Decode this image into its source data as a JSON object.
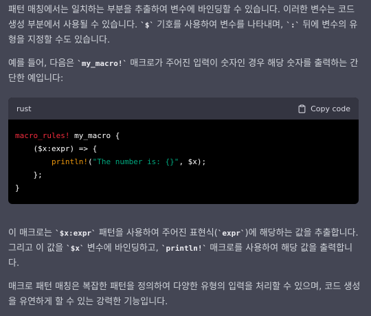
{
  "para1": {
    "t1": "패턴 매칭에서는 일치하는 부분을 추출하여 변수에 바인딩할 수 있습니다. 이러한 변수는 코드 생성 부분에서 사용될 수 있습니다. ",
    "c1": "`$`",
    "t2": " 기호를 사용하여 변수를 나타내며, ",
    "c2": "`:`",
    "t3": " 뒤에 변수의 유형을 지정할 수도 있습니다."
  },
  "para2": {
    "t1": "예를 들어, 다음은 ",
    "c1": "`my_macro!`",
    "t2": " 매크로가 주어진 입력이 숫자인 경우 해당 숫자를 출력하는 간단한 예입니다:"
  },
  "code": {
    "language": "rust",
    "copy_label": "Copy code",
    "copy_icon": "clipboard-icon",
    "l1_kw": "macro_rules!",
    "l1_rest": " my_macro {",
    "l2": "    ($x:expr) => {",
    "l3_indent": "        ",
    "l3_fn": "println!",
    "l3_open": "(",
    "l3_str": "\"The number is: {}\"",
    "l3_rest": ", $x);",
    "l4": "    };",
    "l5": "}"
  },
  "para3": {
    "t1": "이 매크로는 ",
    "c1": "`$x:expr`",
    "t2": " 패턴을 사용하여 주어진 표현식(",
    "c2": "`expr`",
    "t3": ")에 해당하는 값을 추출합니다. 그리고 이 값을 ",
    "c3": "`$x`",
    "t4": " 변수에 바인딩하고, ",
    "c4": "`println!`",
    "t5": " 매크로를 사용하여 해당 값을 출력합니다."
  },
  "para4": {
    "text": "매크로 패턴 매칭은 복잡한 패턴을 정의하여 다양한 유형의 입력을 처리할 수 있으며, 코드 생성을 유연하게 할 수 있는 강력한 기능입니다."
  },
  "colors": {
    "background": "#444654",
    "text": "#d1d5db",
    "code_bg": "#000000",
    "code_header_bg": "#343541",
    "keyword": "#f22c3d",
    "function": "#e9950c",
    "string": "#00a67d"
  }
}
